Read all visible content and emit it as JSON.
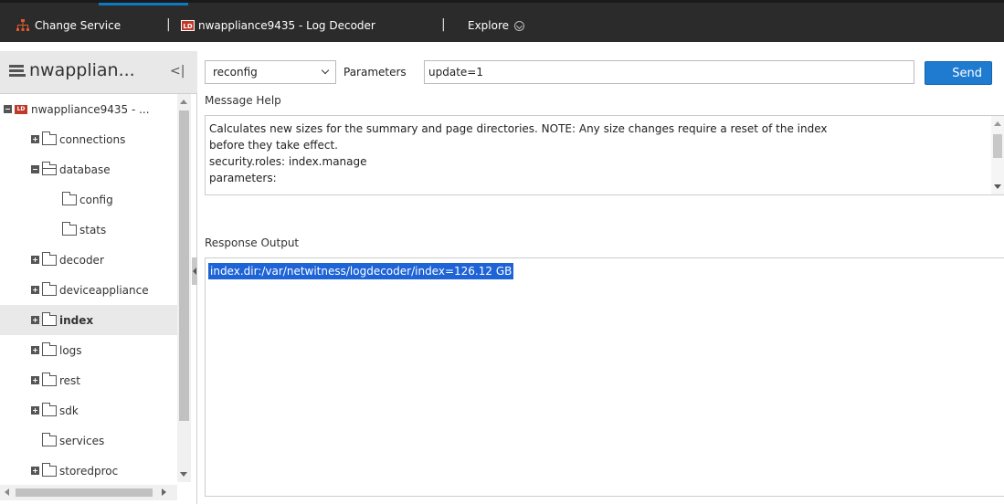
{
  "topbar": {
    "change_service": "Change Service",
    "service_badge": "LD",
    "service_name": "nwappliance9435 - Log Decoder",
    "separator": "|",
    "explore": "Explore"
  },
  "sidebar": {
    "title": "nwapplian...",
    "root_badge": "LD",
    "root_label": "nwappliance9435 - ...",
    "items": [
      {
        "label": "connections"
      },
      {
        "label": "database"
      },
      {
        "label": "config"
      },
      {
        "label": "stats"
      },
      {
        "label": "decoder"
      },
      {
        "label": "deviceappliance"
      },
      {
        "label": "index"
      },
      {
        "label": "logs"
      },
      {
        "label": "rest"
      },
      {
        "label": "sdk"
      },
      {
        "label": "services"
      },
      {
        "label": "storedproc"
      }
    ]
  },
  "command": {
    "selected": "reconfig",
    "parameters_label": "Parameters",
    "parameters_value": "update=1",
    "send_label": "Send"
  },
  "help": {
    "label": "Message Help",
    "text": "Calculates new sizes for the summary and page directories.  NOTE: Any size changes require a reset of the index\nbefore they take effect.\nsecurity.roles: index.manage\nparameters:"
  },
  "output": {
    "label": "Response Output",
    "text": "index.dir:/var/netwitness/logdecoder/index=126.12 GB"
  },
  "colors": {
    "accent": "#1e7bd0",
    "topbar": "#2b2b2b",
    "selection": "#1e64d6",
    "badge": "#c0392b"
  }
}
